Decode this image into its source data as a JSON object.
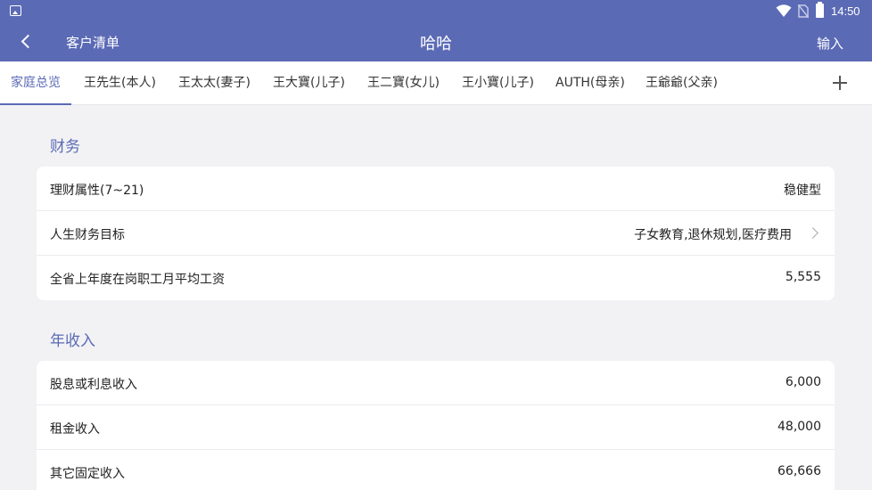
{
  "status": {
    "time": "14:50"
  },
  "appbar": {
    "back_label": "客户清单",
    "title": "哈哈",
    "input_label": "输入"
  },
  "tabs": [
    {
      "label": "家庭总览"
    },
    {
      "label": "王先生(本人)"
    },
    {
      "label": "王太太(妻子)"
    },
    {
      "label": "王大寶(儿子)"
    },
    {
      "label": "王二寶(女儿)"
    },
    {
      "label": "王小寶(儿子)"
    },
    {
      "label": "AUTH(母亲)"
    },
    {
      "label": "王爺爺(父亲)"
    }
  ],
  "finance": {
    "title": "财务",
    "rows": [
      {
        "label": "理财属性(7~21)",
        "value": "稳健型"
      },
      {
        "label": "人生财务目标",
        "value": "子女教育,退休规划,医疗费用"
      },
      {
        "label": "全省上年度在岗职工月平均工资",
        "value": "5,555"
      }
    ]
  },
  "income": {
    "title": "年收入",
    "rows": [
      {
        "label": "股息或利息收入",
        "value": "6,000"
      },
      {
        "label": "租金收入",
        "value": "48,000"
      },
      {
        "label": "其它固定收入",
        "value": "66,666"
      }
    ]
  },
  "colors": {
    "primary": "#5b6ab5",
    "background": "#f2f2f5"
  }
}
